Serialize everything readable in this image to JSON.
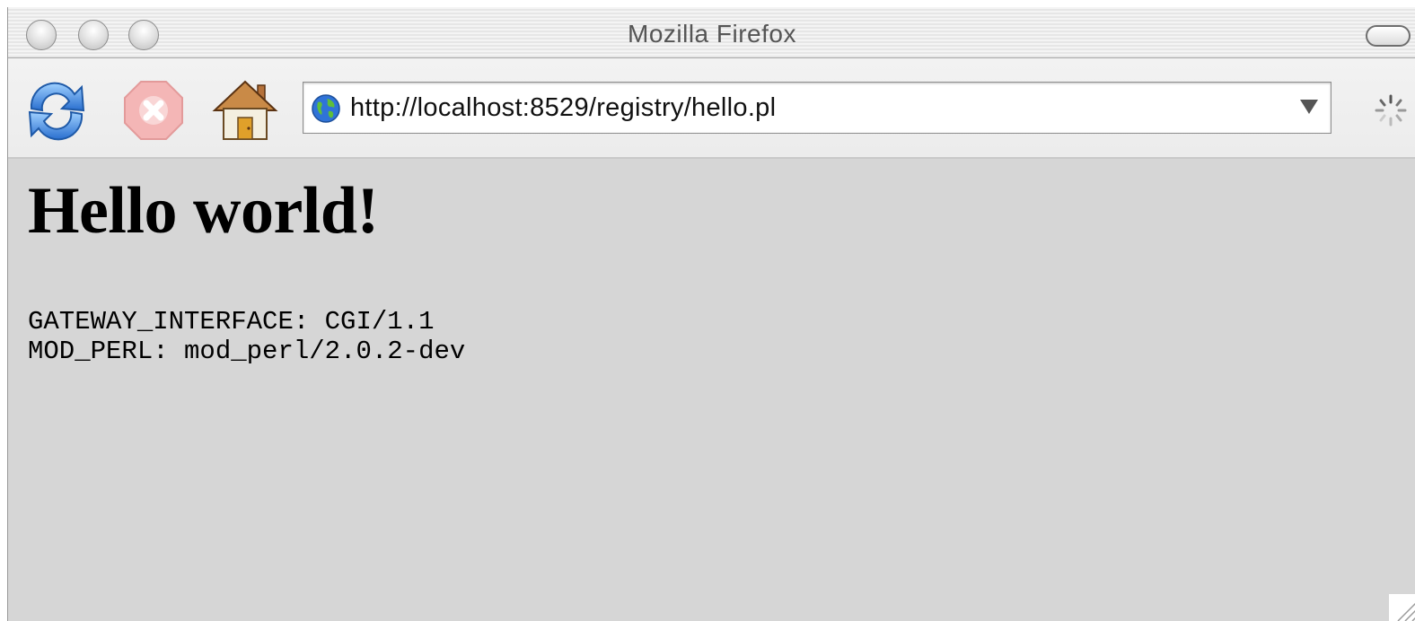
{
  "window": {
    "title": "Mozilla Firefox"
  },
  "toolbar": {
    "url": "http://localhost:8529/registry/hello.pl"
  },
  "page": {
    "heading": "Hello world!",
    "env": [
      "GATEWAY_INTERFACE: CGI/1.1",
      "MOD_PERL: mod_perl/2.0.2-dev"
    ]
  },
  "colors": {
    "content_background": "#d6d6d6",
    "titlebar": "#e6e6e6",
    "close_red": "#e35a5a"
  },
  "icons": [
    "reload-icon",
    "stop-icon",
    "home-icon",
    "globe-icon",
    "dropdown-icon",
    "throbber-icon",
    "resize-grip-icon"
  ]
}
